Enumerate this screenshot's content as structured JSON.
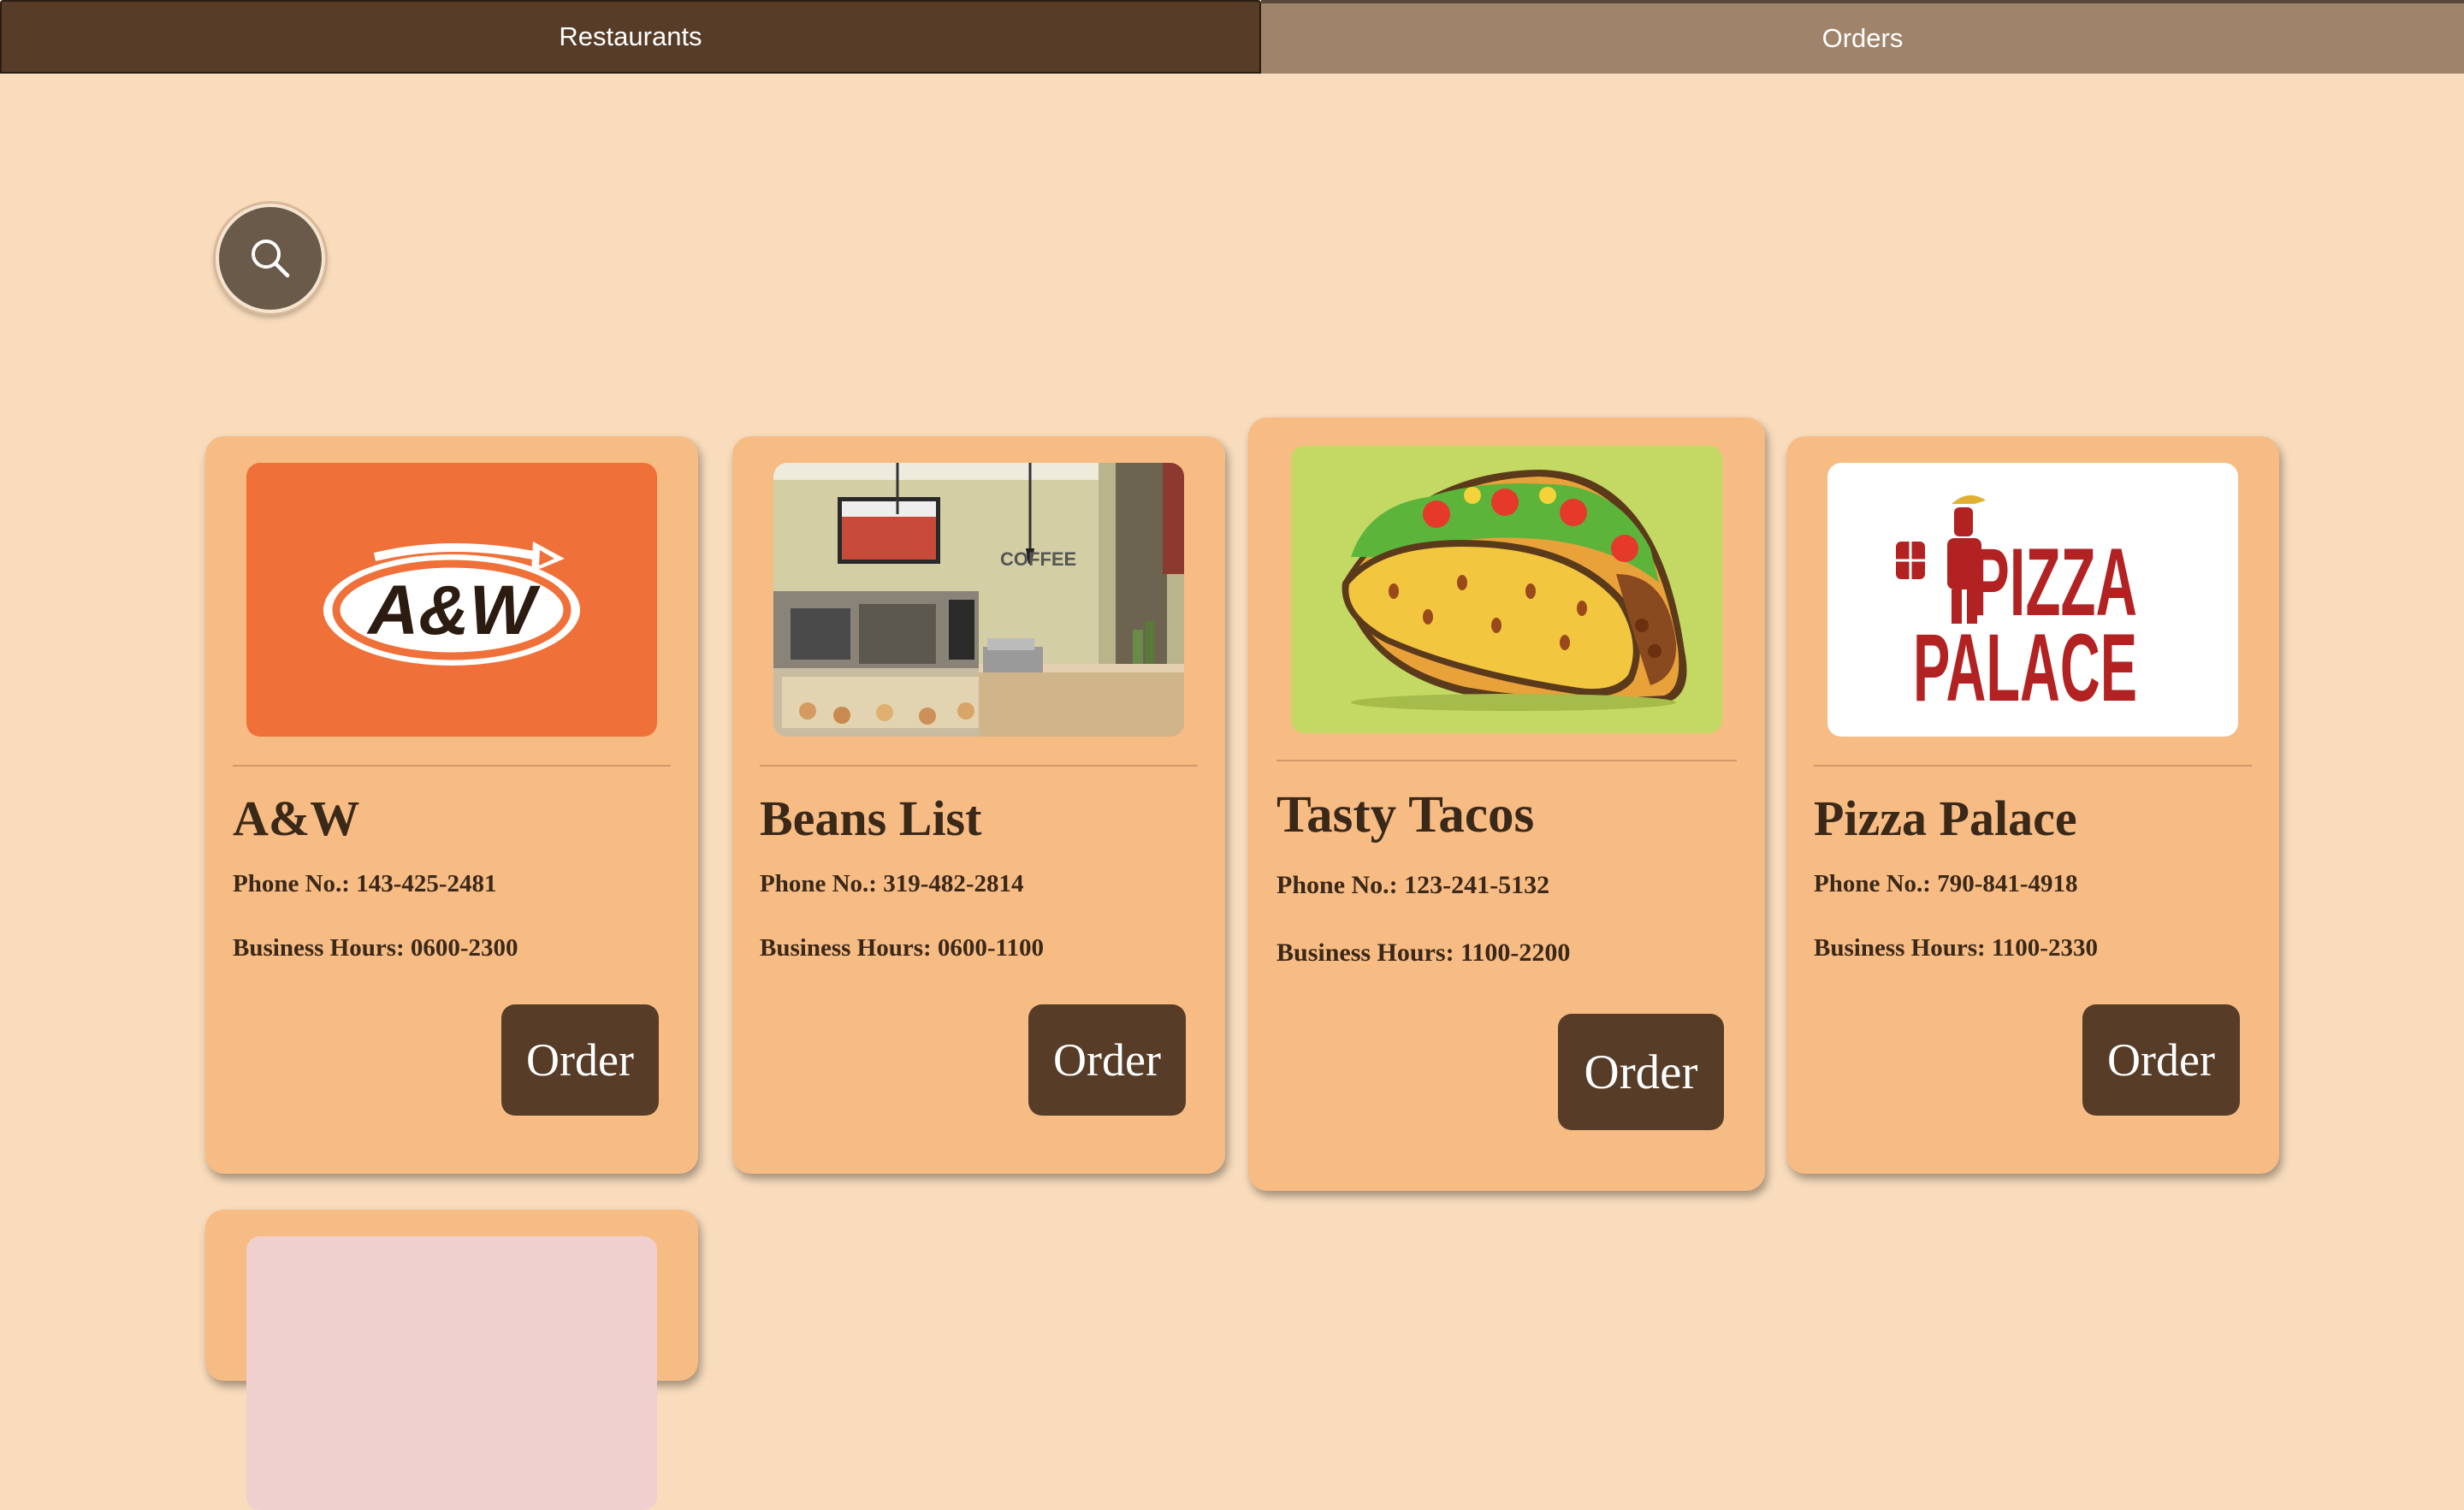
{
  "tabs": {
    "restaurants_label": "Restaurants",
    "orders_label": "Orders"
  },
  "search": {
    "icon": "search-icon"
  },
  "restaurants": [
    {
      "name": "A&W",
      "phone": "Phone No.: 143-425-2481",
      "hours": "Business Hours: 0600-2300",
      "order_label": "Order",
      "logo_text": "A&W"
    },
    {
      "name": "Beans List",
      "phone": "Phone No.: 319-482-2814",
      "hours": "Business Hours: 0600-1100",
      "order_label": "Order",
      "sign_text": "COFFEE"
    },
    {
      "name": "Tasty Tacos",
      "phone": "Phone No.: 123-241-5132",
      "hours": "Business Hours: 1100-2200",
      "order_label": "Order"
    },
    {
      "name": "Pizza Palace",
      "phone": "Phone No.: 790-841-4918",
      "hours": "Business Hours: 1100-2330",
      "order_label": "Order",
      "logo_line1": "PIZZA",
      "logo_line2": "PALACE"
    }
  ],
  "colors": {
    "background": "#f8dcbc",
    "card": "#f7bb84",
    "accent_dark": "#573c27",
    "tab_inactive": "#a0836b"
  }
}
